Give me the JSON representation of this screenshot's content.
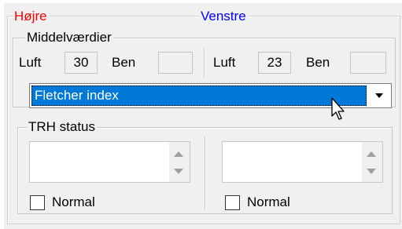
{
  "groups": {
    "right_side": "Højre",
    "left_side": "Venstre",
    "averages": "Middelværdier",
    "trh_status": "TRH status"
  },
  "right": {
    "air_label": "Luft",
    "air_value": "30",
    "bone_label": "Ben",
    "bone_value": ""
  },
  "left": {
    "air_label": "Luft",
    "air_value": "23",
    "bone_label": "Ben",
    "bone_value": ""
  },
  "index_dropdown": {
    "selected": "Fletcher index"
  },
  "trh": {
    "right_normal_label": "Normal",
    "right_normal_checked": false,
    "left_normal_label": "Normal",
    "left_normal_checked": false
  },
  "colors": {
    "right_legend": "#ff0000",
    "left_legend": "#0000ff",
    "selection": "#0078d7"
  }
}
